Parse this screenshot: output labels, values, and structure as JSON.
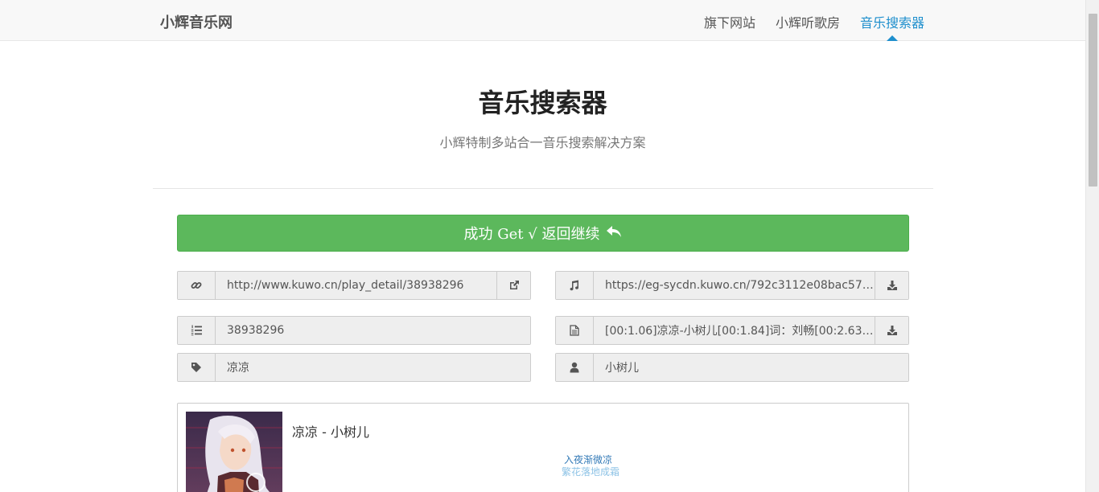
{
  "nav": {
    "brand": "小辉音乐网",
    "items": [
      {
        "label": "旗下网站"
      },
      {
        "label": "小辉听歌房"
      },
      {
        "label": "音乐搜索器"
      }
    ]
  },
  "hero": {
    "title": "音乐搜索器",
    "subtitle": "小辉特制多站合一音乐搜索解决方案"
  },
  "success_button": {
    "label": "成功 Get √ 返回继续"
  },
  "fields": {
    "link": "http://www.kuwo.cn/play_detail/38938296",
    "music_url": "https://eg-sycdn.kuwo.cn/792c3112e08bac57001b...",
    "song_id": "38938296",
    "lyrics": "[00:1.06]凉凉-小树儿[00:1.84]词：刘畅[00:2.63]曲...",
    "song_name": "凉凉",
    "artist": "小树儿"
  },
  "player": {
    "title": "凉凉 - 小树儿",
    "lyric_current": "入夜渐微凉",
    "lyric_next": "繁花落地成霜"
  },
  "colors": {
    "accent": "#1f8fcd",
    "success": "#5cb85c"
  },
  "icons": {
    "link": "link-icon",
    "external": "external-link-icon",
    "music": "music-note-icon",
    "download": "download-icon",
    "list": "list-ol-icon",
    "file": "file-text-icon",
    "tag": "tag-icon",
    "user": "user-icon",
    "reply": "reply-icon"
  }
}
